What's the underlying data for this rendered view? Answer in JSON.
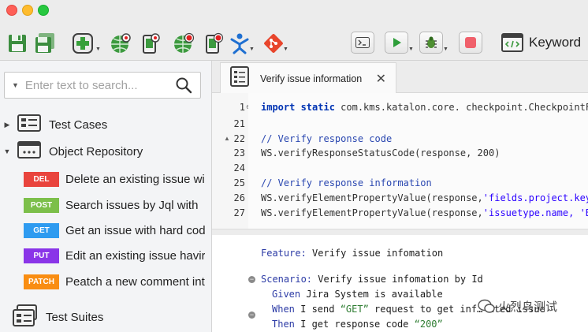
{
  "toolbar": {
    "keyword_label": "Keyword",
    "icons": [
      "save-icon",
      "save-all-icon",
      "new-icon",
      "spy-web-icon",
      "spy-mobile-icon",
      "record-web-icon",
      "record-mobile-icon",
      "spy-windows-icon",
      "git-icon",
      "terminal-icon",
      "run-icon",
      "debug-icon",
      "stop-icon",
      "keyword-icon"
    ]
  },
  "explorer": {
    "search_placeholder": "Enter text to search...",
    "test_cases": "Test Cases",
    "object_repository": "Object Repository",
    "requests": [
      {
        "method": "DEL",
        "color": "#e9443d",
        "label": "Delete an existing issue wi"
      },
      {
        "method": "POST",
        "color": "#7cbf4a",
        "label": "Search issues by Jql with"
      },
      {
        "method": "GET",
        "color": "#2e9bf0",
        "label": "Get an issue with hard cod"
      },
      {
        "method": "PUT",
        "color": "#8a35e8",
        "label": "Edit an existing issue havir"
      },
      {
        "method": "PATCH",
        "color": "#f98d12",
        "label": "Peatch a new comment int"
      }
    ],
    "test_suites": "Test Suites"
  },
  "editor": {
    "tab_title": "Verify issue information",
    "line_numbers": [
      "1",
      "21",
      "22",
      "23",
      "24",
      "25",
      "26",
      "27"
    ],
    "code": {
      "l1_kw": "import static",
      "l1_rest": " com.kms.katalon.core. checkpoint.CheckpointF",
      "l22": "// Verify response code",
      "l23": "WS.verifyResponseStatusCode(response, 200)",
      "l25": "// Verify response information",
      "l26_pre": "WS.verifyElementPropertyValue(response,",
      "l26_str": "'fields.project.key",
      "l27_pre": "WS.verifyElementPropertyValue(response,",
      "l27_str": "'issuetype.name, 'B"
    },
    "gherkin": {
      "feature_kw": "Feature:",
      "feature_text": " Verify issue infomation",
      "scenario_kw": "Scenario:",
      "scenario_text": " Verify issue infomation by Id",
      "given_kw": "Given",
      "given_text": " Jira System is available",
      "when_kw": "When",
      "when_pre": " I send ",
      "when_str": "“GET”",
      "when_post": " request to get inf… …ted issue",
      "then_kw": "Then",
      "then_pre": " I get response code ",
      "then_str": "“200”"
    }
  },
  "watermark": "火烈鸟测试"
}
